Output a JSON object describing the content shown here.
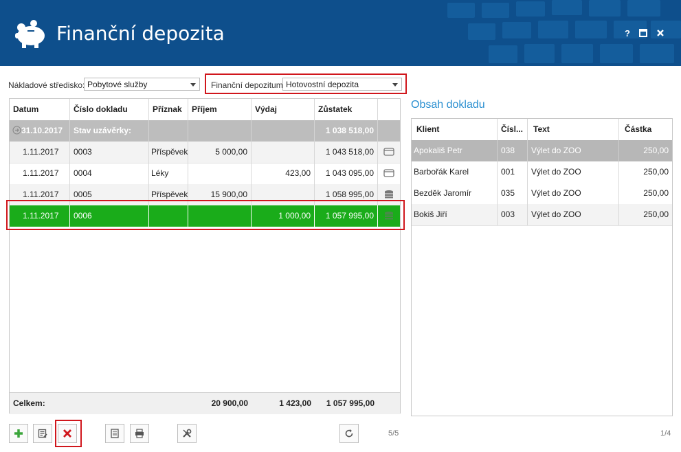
{
  "header": {
    "title": "Finanční depozita",
    "help_label": "?",
    "bg_color": "#0e4f8c"
  },
  "filters": {
    "cost_center_label": "Nákladové středisko:",
    "cost_center_value": "Pobytové služby",
    "deposit_label": "Finanční depozitum:",
    "deposit_value": "Hotovostní depozita"
  },
  "grid": {
    "columns": [
      "Datum",
      "Číslo dokladu",
      "Příznak",
      "Příjem",
      "Výdaj",
      "Zůstatek"
    ],
    "group_row": {
      "date": "31.10.2017",
      "label": "Stav uzávěrky:",
      "balance": "1 038 518,00"
    },
    "rows": [
      {
        "date": "1.11.2017",
        "doc": "0003",
        "flag": "Příspěvek",
        "income": "5 000,00",
        "expense": "",
        "balance": "1 043 518,00",
        "icon": "card-icon"
      },
      {
        "date": "1.11.2017",
        "doc": "0004",
        "flag": "Léky",
        "income": "",
        "expense": "423,00",
        "balance": "1 043 095,00",
        "icon": "card-icon"
      },
      {
        "date": "1.11.2017",
        "doc": "0005",
        "flag": "Příspěvek",
        "income": "15 900,00",
        "expense": "",
        "balance": "1 058 995,00",
        "icon": "coins-icon"
      },
      {
        "date": "1.11.2017",
        "doc": "0006",
        "flag": "",
        "income": "",
        "expense": "1 000,00",
        "balance": "1 057 995,00",
        "icon": "coins-icon"
      }
    ],
    "totals": {
      "label": "Celkem:",
      "income": "20 900,00",
      "expense": "1 423,00",
      "balance": "1 057 995,00"
    },
    "selected_color": "#1aac1a"
  },
  "detail": {
    "title": "Obsah dokladu",
    "columns": [
      "Klient",
      "Čísl...",
      "Text",
      "Částka"
    ],
    "rows": [
      {
        "client": "Apokališ Petr",
        "num": "038",
        "text": "Výlet do ZOO",
        "amount": "250,00"
      },
      {
        "client": "Barbořák Karel",
        "num": "001",
        "text": "Výlet do ZOO",
        "amount": "250,00"
      },
      {
        "client": "Bezděk Jaromír",
        "num": "035",
        "text": "Výlet do ZOO",
        "amount": "250,00"
      },
      {
        "client": "Bokiš Jiří",
        "num": "003",
        "text": "Výlet do ZOO",
        "amount": "250,00"
      }
    ]
  },
  "toolbar": {
    "left_pager": "5/5",
    "right_pager": "1/4",
    "icons": [
      "add-icon",
      "edit-icon",
      "delete-icon",
      "document-icon",
      "print-icon",
      "tools-icon",
      "refresh-icon"
    ]
  },
  "accent_colors": {
    "highlight_red": "#d0161c",
    "title_blue": "#2a8fd0"
  }
}
